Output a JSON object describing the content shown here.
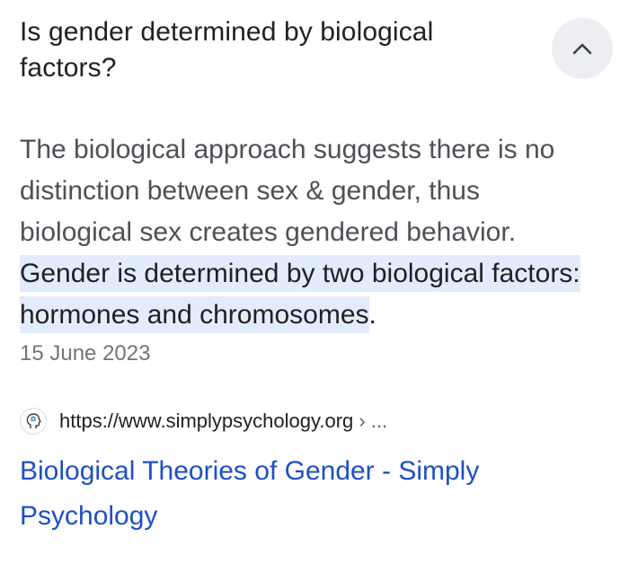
{
  "question": {
    "text": "Is gender determined by biological factors?",
    "expanded": true
  },
  "answer": {
    "plain": "The biological approach suggests there is no distinction between sex & gender, thus biological sex creates gendered behavior. ",
    "highlight": "Gender is determined by two biological factors: hormones and chromosomes",
    "trailing": "."
  },
  "date": "15 June 2023",
  "source": {
    "url": "https://www.simplypsychology.org",
    "separator": " › ...",
    "favicon": "head-profile-icon"
  },
  "result": {
    "title": "Biological Theories of Gender - Simply Psychology"
  },
  "colors": {
    "highlight_bg": "#e3ecfd",
    "link": "#1f4fc4",
    "body_text": "#4d5156",
    "heading_text": "#202124",
    "date_text": "#70757a",
    "button_bg": "#eceef1"
  }
}
